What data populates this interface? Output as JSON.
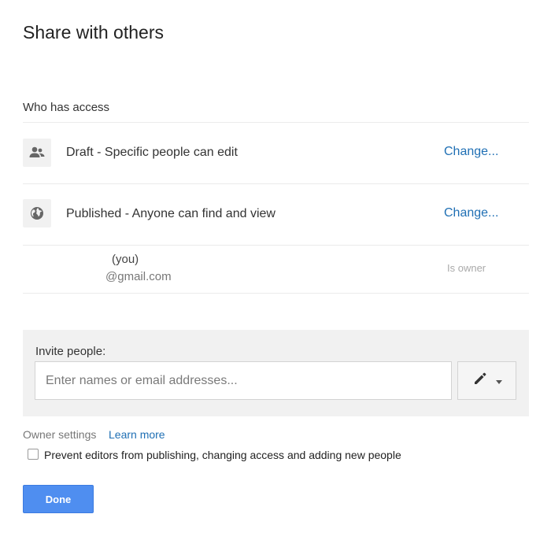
{
  "dialog": {
    "title": "Share with others"
  },
  "access": {
    "section_label": "Who has access",
    "rows": [
      {
        "icon": "people-icon",
        "text": "Draft - Specific people can edit",
        "link": "Change..."
      },
      {
        "icon": "globe-icon",
        "text": "Published - Anyone can find and view",
        "link": "Change..."
      }
    ],
    "owner": {
      "name": "(you)",
      "email": "@gmail.com",
      "role": "Is owner"
    }
  },
  "invite": {
    "label": "Invite people:",
    "placeholder": "Enter names or email addresses...",
    "permission_icon": "pencil-icon",
    "dropdown_icon": "caret-down-icon"
  },
  "settings": {
    "owner_settings_label": "Owner settings",
    "learn_more": "Learn more",
    "prevent_editors_label": "Prevent editors from publishing, changing access and adding new people",
    "prevent_editors_checked": false
  },
  "actions": {
    "done": "Done"
  },
  "colors": {
    "link": "#1f6fb4",
    "primary_button": "#4f8ef0",
    "invite_background": "#f1f1f1"
  }
}
